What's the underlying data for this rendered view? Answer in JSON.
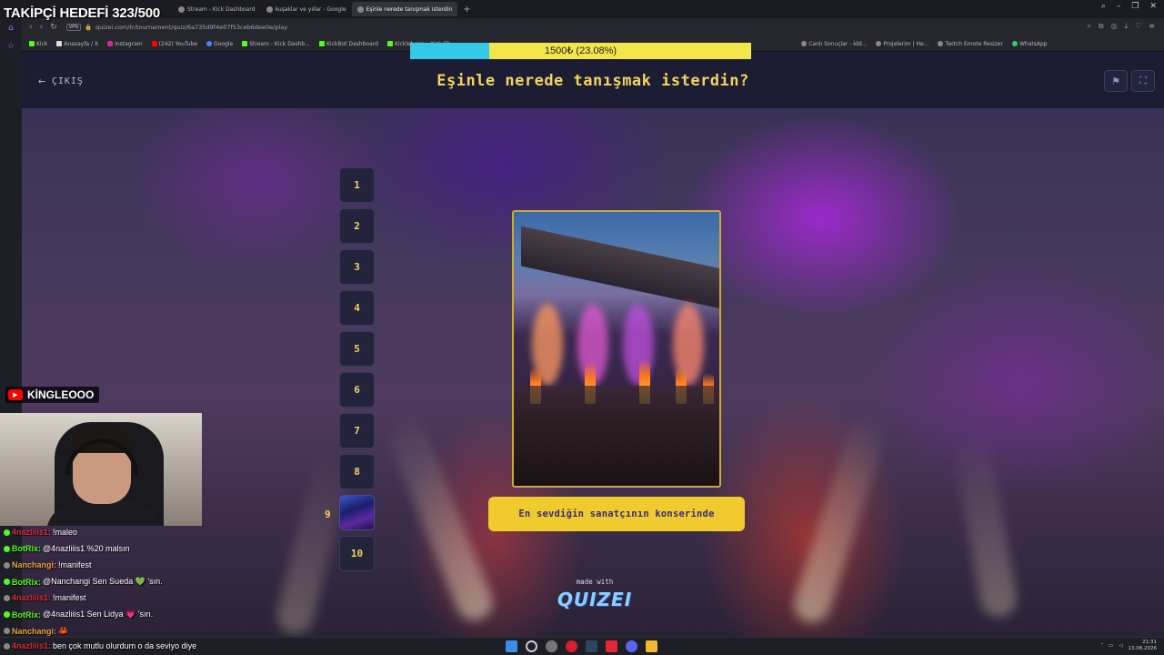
{
  "overlay": {
    "goal_text": "TAKİPÇİ HEDEFİ 323/500",
    "progress_text": "1500₺ (23.08%)",
    "progress_fraction": 0.2308,
    "channel_name": "KİNGLEOOO"
  },
  "browser": {
    "tabs": [
      {
        "label": "Kick ... Önce ...",
        "active": false
      },
      {
        "label": "Stream - Kick Dashboard",
        "active": false
      },
      {
        "label": "kuşaklar ve yıllar - Google",
        "active": false
      },
      {
        "label": "Eşinle nerede tanışmak isterdin",
        "active": true
      }
    ],
    "url": "quizei.com/tr/tournament/quiz/6a735d9f4e07f53ceb6dee0e/play",
    "vpn_label": "VPN",
    "bookmarks": [
      {
        "label": "Kick",
        "icon": "kick-icon"
      },
      {
        "label": "Anasayfa / X",
        "icon": "x-icon"
      },
      {
        "label": "Instagram",
        "icon": "instagram-icon"
      },
      {
        "label": "(242) YouTube",
        "icon": "youtube-icon"
      },
      {
        "label": "Google",
        "icon": "google-icon"
      },
      {
        "label": "Stream - Kick Dashb...",
        "icon": "kick-icon"
      },
      {
        "label": "KickBot Dashboard",
        "icon": "kick-icon"
      },
      {
        "label": "Kicklet.app - Kick Ch...",
        "icon": "kick-icon"
      },
      {
        "label": "Canlı Sonuçlar - İdd...",
        "icon": "site-icon"
      },
      {
        "label": "Projelerim | He...",
        "icon": "site-icon"
      },
      {
        "label": "Twitch Emote Resizer",
        "icon": "site-icon"
      },
      {
        "label": "WhatsApp",
        "icon": "whatsapp-icon"
      }
    ]
  },
  "quiz": {
    "exit_label": "ÇIKIŞ",
    "question": "Eşinle nerede tanışmak isterdin?",
    "numbers": [
      "1",
      "2",
      "3",
      "4",
      "5",
      "6",
      "7",
      "8",
      "",
      "10"
    ],
    "current_index_label": "9",
    "answer": "En sevdiğin sanatçının konserinde",
    "made_with": "made with",
    "brand": "QUIZEI"
  },
  "chat": [
    {
      "user": "4nazliiis1:",
      "text": "!maleo",
      "color": "#e0283a"
    },
    {
      "user": "BotRix:",
      "text": "@4nazliiis1 %20 malsın",
      "color": "#53fc18"
    },
    {
      "user": "Nanchangi:",
      "text": "!manifest",
      "color": "#e9a23b"
    },
    {
      "user": "BotRix:",
      "text": "@Nanchangi Sen Sueda 💚 'sın.",
      "color": "#53fc18"
    },
    {
      "user": "4nazliiis1:",
      "text": "!manifest",
      "color": "#e0283a"
    },
    {
      "user": "BotRix:",
      "text": "@4nazliiis1 Sen Lidya 💗 'sın.",
      "color": "#53fc18"
    },
    {
      "user": "Nanchangi:",
      "text": "🦀",
      "color": "#e9a23b"
    },
    {
      "user": "4nazliiis1:",
      "text": "ben çok mutlu olurdum o da seviyo diye",
      "color": "#e0283a"
    }
  ],
  "taskbar": {
    "time": "21:31",
    "date": "13.08.2026"
  }
}
